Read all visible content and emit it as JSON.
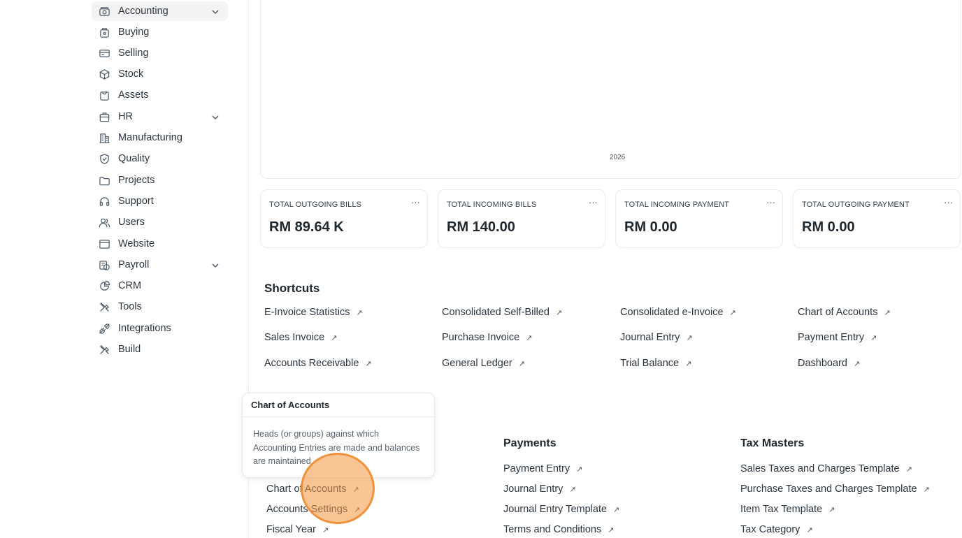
{
  "sidebar": {
    "items": [
      {
        "label": "Accounting",
        "icon": "accounting-icon",
        "expandable": true,
        "active": true
      },
      {
        "label": "Buying",
        "icon": "buying-icon",
        "expandable": false
      },
      {
        "label": "Selling",
        "icon": "selling-icon",
        "expandable": false
      },
      {
        "label": "Stock",
        "icon": "stock-icon",
        "expandable": false
      },
      {
        "label": "Assets",
        "icon": "assets-icon",
        "expandable": false
      },
      {
        "label": "HR",
        "icon": "hr-icon",
        "expandable": true
      },
      {
        "label": "Manufacturing",
        "icon": "manufacturing-icon",
        "expandable": false
      },
      {
        "label": "Quality",
        "icon": "quality-icon",
        "expandable": false
      },
      {
        "label": "Projects",
        "icon": "projects-icon",
        "expandable": false
      },
      {
        "label": "Support",
        "icon": "support-icon",
        "expandable": false
      },
      {
        "label": "Users",
        "icon": "users-icon",
        "expandable": false
      },
      {
        "label": "Website",
        "icon": "website-icon",
        "expandable": false
      },
      {
        "label": "Payroll",
        "icon": "payroll-icon",
        "expandable": true
      },
      {
        "label": "CRM",
        "icon": "crm-icon",
        "expandable": false
      },
      {
        "label": "Tools",
        "icon": "tools-icon",
        "expandable": false
      },
      {
        "label": "Integrations",
        "icon": "integrations-icon",
        "expandable": false
      },
      {
        "label": "Build",
        "icon": "build-icon",
        "expandable": false
      }
    ]
  },
  "chart": {
    "x_tick": "2026"
  },
  "stats": [
    {
      "title": "TOTAL OUTGOING BILLS",
      "value": "RM 89.64 K",
      "menu": "···"
    },
    {
      "title": "TOTAL INCOMING BILLS",
      "value": "RM 140.00",
      "menu": "···"
    },
    {
      "title": "TOTAL INCOMING PAYMENT",
      "value": "RM 0.00",
      "menu": "···"
    },
    {
      "title": "TOTAL OUTGOING PAYMENT",
      "value": "RM 0.00",
      "menu": "···"
    }
  ],
  "shortcuts": {
    "title": "Shortcuts",
    "items": [
      "E-Invoice Statistics",
      "Consolidated Self-Billed",
      "Consolidated e-Invoice",
      "Chart of Accounts",
      "Sales Invoice",
      "Purchase Invoice",
      "Journal Entry",
      "Payment Entry",
      "Accounts Receivable",
      "General Ledger",
      "Trial Balance",
      "Dashboard"
    ],
    "arrow": "↗"
  },
  "cards": {
    "masters": {
      "items": [
        "Chart of Accounts",
        "Accounts Settings",
        "Fiscal Year"
      ]
    },
    "payments": {
      "title": "Payments",
      "items": [
        "Payment Entry",
        "Journal Entry",
        "Journal Entry Template",
        "Terms and Conditions"
      ]
    },
    "tax_masters": {
      "title": "Tax Masters",
      "items": [
        "Sales Taxes and Charges Template",
        "Purchase Taxes and Charges Template",
        "Item Tax Template",
        "Tax Category"
      ]
    }
  },
  "tooltip": {
    "title": "Chart of Accounts",
    "body": "Heads (or groups) against which Accounting Entries are made and balances are maintained."
  },
  "colors": {
    "click_highlight": "#f5963c",
    "active_nav_bg": "#f3f3f3"
  }
}
